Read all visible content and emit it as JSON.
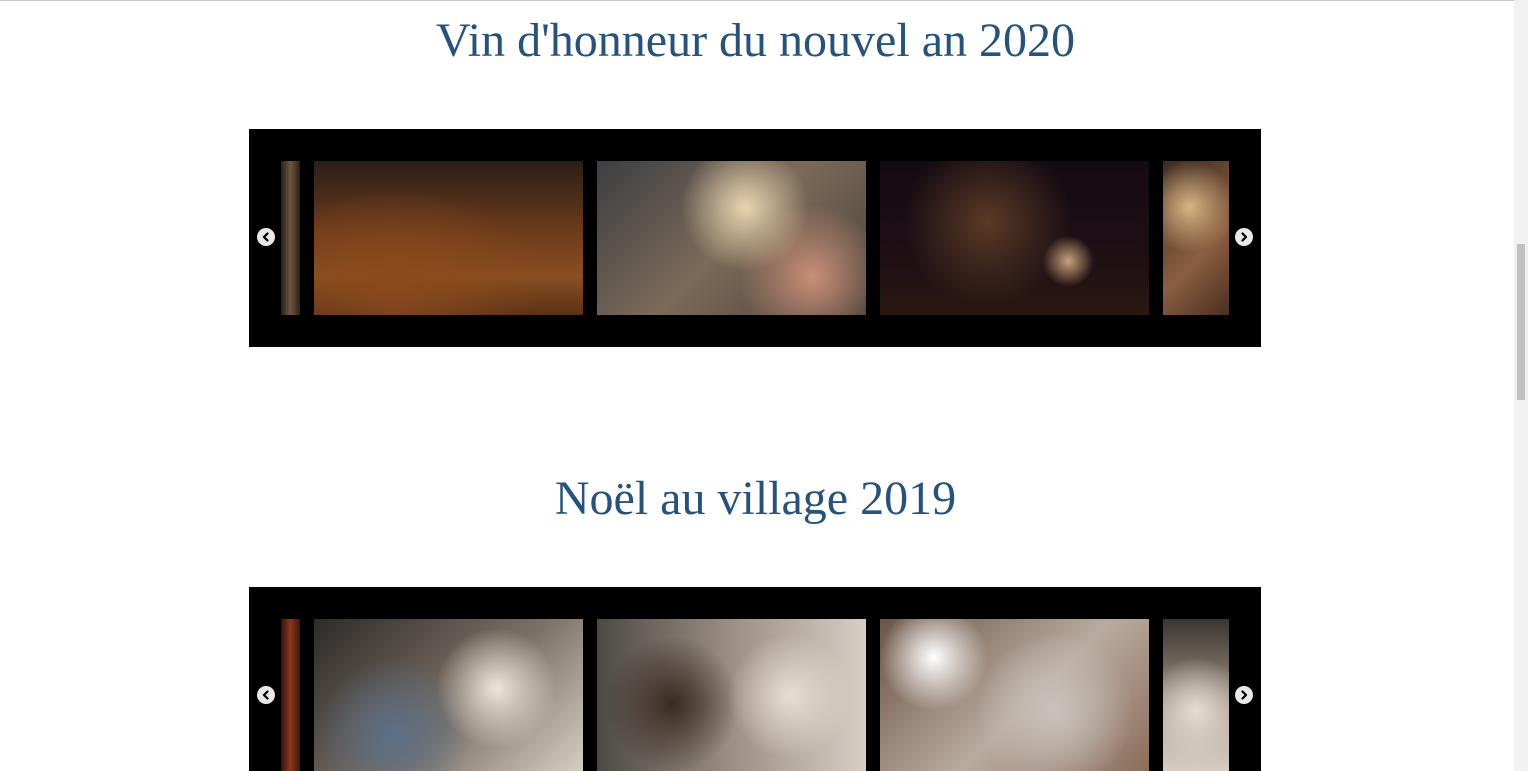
{
  "sections": [
    {
      "title": "Vin d'honneur du nouvel an 2020",
      "slides": [
        {
          "icon": "photo-partial",
          "description": ""
        },
        {
          "icon": "photo"
        },
        {
          "icon": "photo"
        },
        {
          "icon": "photo"
        },
        {
          "icon": "photo-partial"
        }
      ]
    },
    {
      "title": "Noël au village 2019",
      "slides": [
        {
          "icon": "photo-partial"
        },
        {
          "icon": "photo"
        },
        {
          "icon": "photo"
        },
        {
          "icon": "photo"
        },
        {
          "icon": "photo-partial"
        }
      ]
    }
  ],
  "controls": {
    "prev_icon": "chevron-left-circle-icon",
    "next_icon": "chevron-right-circle-icon"
  },
  "colors": {
    "title": "#25527f",
    "carousel_bg": "#000000",
    "page_bg": "#ffffff"
  }
}
